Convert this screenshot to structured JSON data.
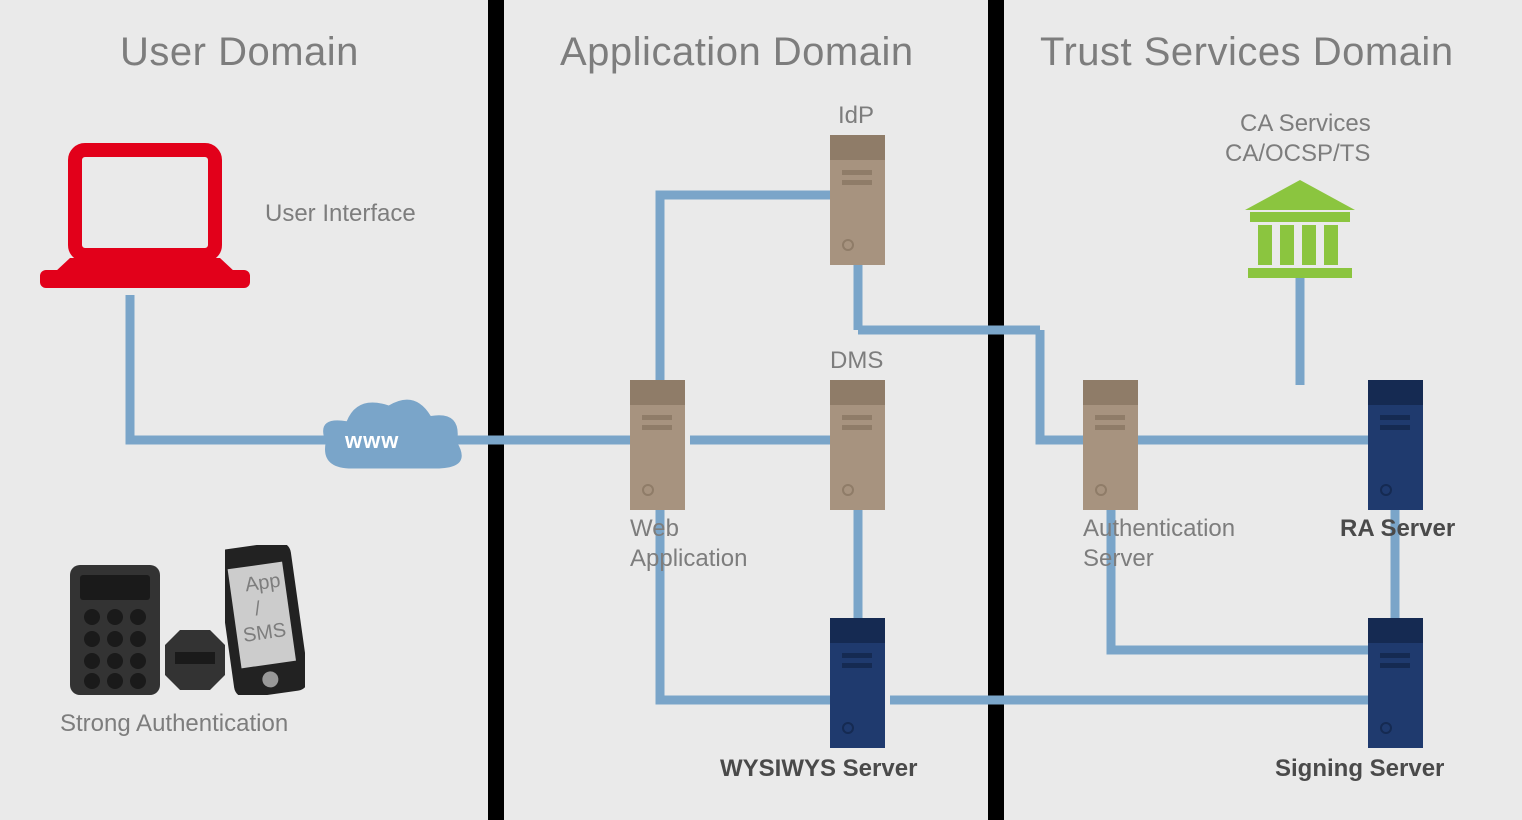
{
  "domains": {
    "user": "User Domain",
    "application": "Application Domain",
    "trust": "Trust Services Domain"
  },
  "nodes": {
    "userInterface": "User Interface",
    "strongAuth": "Strong Authentication",
    "cloud": "www",
    "webApp": "Web\nApplication",
    "webAppLine1": "Web",
    "webAppLine2": "Application",
    "idp": "IdP",
    "dms": "DMS",
    "wysiwys": "WYSIWYS Server",
    "caServices1": "CA Services",
    "caServices2": "CA/OCSP/TS",
    "raServer": "RA Server",
    "authServer1": "Authentication",
    "authServer2": "Server",
    "signingServer": "Signing Server",
    "phoneApp": "App",
    "phoneSlash": "/",
    "phoneSms": "SMS"
  },
  "colors": {
    "red": "#e2001a",
    "blue": "#2a4e8a",
    "lineBlue": "#7aa5c9",
    "brown": "#a7937f",
    "green": "#8bc53f",
    "grayText": "#7d7d7d",
    "darkGray": "#333333"
  }
}
